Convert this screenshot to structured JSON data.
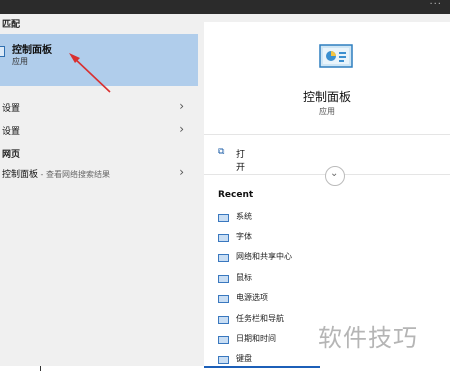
{
  "left": {
    "best_match_label": "匹配",
    "best_match": {
      "title": "控制面板",
      "subtitle": "应用"
    },
    "settings_items": [
      {
        "label": "设置"
      },
      {
        "label": "设置"
      }
    ],
    "web_label": "网页",
    "web_item": {
      "label": "控制面板",
      "suffix": " - 查看网络搜索结果"
    }
  },
  "right": {
    "app_title": "控制面板",
    "app_subtitle": "应用",
    "open_label": "打开",
    "recent_heading": "Recent",
    "recent_items": [
      "系统",
      "字体",
      "网络和共享中心",
      "鼠标",
      "电源选项",
      "任务栏和导航",
      "日期和时间",
      "键盘"
    ]
  },
  "watermark": "软件技巧",
  "colors": {
    "selection": "#b0cdeb",
    "accent": "#1c5fb8",
    "arrow": "#d93030"
  }
}
